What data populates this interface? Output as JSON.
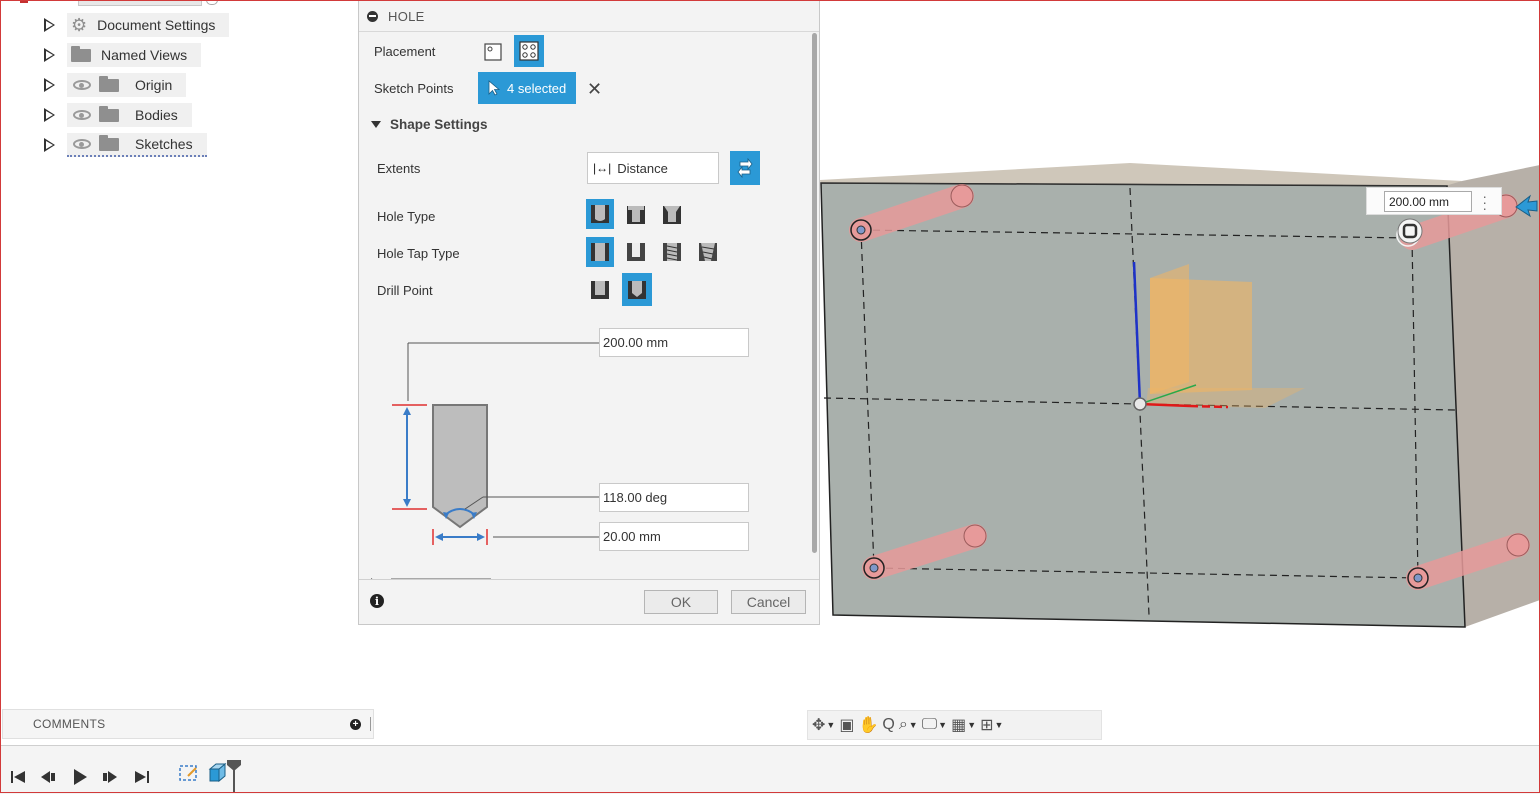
{
  "browser": {
    "items": [
      {
        "label": "Document Settings",
        "icon": "gear-icon"
      },
      {
        "label": "Named Views",
        "icon": "folder-icon"
      },
      {
        "label": "Origin",
        "icon": "folder-icon",
        "visible": true
      },
      {
        "label": "Bodies",
        "icon": "folder-icon",
        "visible": true
      },
      {
        "label": "Sketches",
        "icon": "folder-icon",
        "visible": true
      }
    ]
  },
  "hole_panel": {
    "title": "HOLE",
    "placement_label": "Placement",
    "sketch_points_label": "Sketch Points",
    "sketch_points_value": "4 selected",
    "shape_settings_label": "Shape Settings",
    "extents_label": "Extents",
    "extents_value": "Distance",
    "hole_type_label": "Hole Type",
    "hole_tap_type_label": "Hole Tap Type",
    "drill_point_label": "Drill Point",
    "depth_value": "200.00 mm",
    "angle_value": "118.00 deg",
    "diameter_value": "20.00 mm",
    "ok_label": "OK",
    "cancel_label": "Cancel"
  },
  "viewport": {
    "dimension_value": "200.00 mm"
  },
  "comments": {
    "label": "COMMENTS"
  },
  "colors": {
    "accent": "#2b99d6",
    "body_face": "#a9b0ac",
    "hole_cylinder": "#e79a9a"
  }
}
